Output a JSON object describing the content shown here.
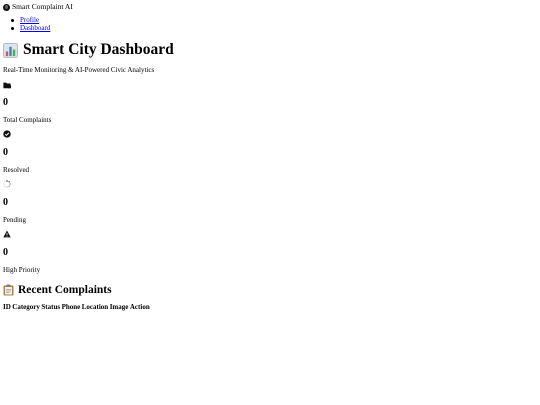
{
  "brand": {
    "name": "Smart Complaint AI",
    "icon": "globe-icon"
  },
  "nav": {
    "items": [
      {
        "label": "Profile"
      },
      {
        "label": "Dashboard"
      }
    ]
  },
  "header": {
    "title": "Smart City Dashboard",
    "icon": "bar-chart-icon",
    "subtitle": "Real-Time Monitoring & AI-Powered Civic Analytics"
  },
  "stats": [
    {
      "value": "0",
      "label": "Total Complaints",
      "icon": "folder-icon"
    },
    {
      "value": "0",
      "label": "Resolved",
      "icon": "check-circle-icon"
    },
    {
      "value": "0",
      "label": "Pending",
      "icon": "spinner-icon"
    },
    {
      "value": "0",
      "label": "High Priority",
      "icon": "warning-icon"
    }
  ],
  "recent": {
    "title": "Recent Complaints",
    "icon": "clipboard-icon",
    "columns": [
      "ID",
      "Category",
      "Status",
      "Phone",
      "Location",
      "Image",
      "Action"
    ]
  }
}
